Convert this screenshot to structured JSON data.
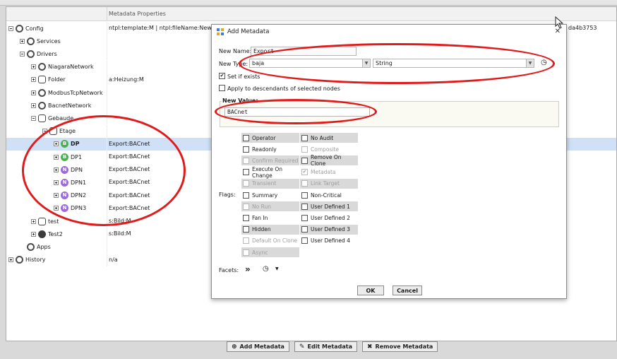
{
  "header": {
    "metadata_properties": "Metadata Properties"
  },
  "tree": [
    {
      "label": "Config",
      "value": "ntpl:template:M | ntpl:fileName:NewCon"
    },
    {
      "label": "Services",
      "value": ""
    },
    {
      "label": "Drivers",
      "value": ""
    },
    {
      "label": "NiagaraNetwork",
      "value": ""
    },
    {
      "label": "Folder",
      "value": "a:Heizung:M"
    },
    {
      "label": "ModbusTcpNetwork",
      "value": ""
    },
    {
      "label": "BacnetNetwork",
      "value": ""
    },
    {
      "label": "Gebaude",
      "value": ""
    },
    {
      "label": "Etage",
      "value": ""
    },
    {
      "label": "DP",
      "value": "Export:BACnet"
    },
    {
      "label": "DP1",
      "value": "Export:BACnet"
    },
    {
      "label": "DPN",
      "value": "Export:BACnet"
    },
    {
      "label": "DPN1",
      "value": "Export:BACnet"
    },
    {
      "label": "DPN2",
      "value": "Export:BACnet"
    },
    {
      "label": "DPN3",
      "value": "Export:BACnet"
    },
    {
      "label": "test",
      "value": "s:Bild:M"
    },
    {
      "label": "Test2",
      "value": "s:Bild:M"
    },
    {
      "label": "Apps",
      "value": ""
    },
    {
      "label": "History",
      "value": "n/a"
    }
  ],
  "right_fragment": "da4b3753",
  "toolbar": {
    "add": "Add Metadata",
    "edit": "Edit Metadata",
    "remove": "Remove Metadata"
  },
  "dialog": {
    "title": "Add Metadata",
    "new_name_label": "New Name:",
    "new_name_value": "Export",
    "new_type_label": "New Type:",
    "type_module": "baja",
    "type_name": "String",
    "set_if_exists": "Set if exists",
    "apply_descendants": "Apply to descendants of selected nodes",
    "new_value_label": "New Value:",
    "new_value": "BACnet",
    "flags_label": "Flags:",
    "flags_left": [
      {
        "label": "Operator",
        "checked": false,
        "disabled": false
      },
      {
        "label": "Readonly",
        "checked": false,
        "disabled": false
      },
      {
        "label": "Confirm Required",
        "checked": false,
        "disabled": true
      },
      {
        "label": "Execute On Change",
        "checked": false,
        "disabled": false
      },
      {
        "label": "Transient",
        "checked": false,
        "disabled": true
      },
      {
        "label": "Summary",
        "checked": false,
        "disabled": false
      },
      {
        "label": "No Run",
        "checked": false,
        "disabled": true
      },
      {
        "label": "Fan In",
        "checked": false,
        "disabled": false
      },
      {
        "label": "Hidden",
        "checked": false,
        "disabled": false
      },
      {
        "label": "Default On Clone",
        "checked": false,
        "disabled": true
      },
      {
        "label": "Async",
        "checked": false,
        "disabled": true
      }
    ],
    "flags_right": [
      {
        "label": "No Audit",
        "checked": false,
        "disabled": false
      },
      {
        "label": "Composite",
        "checked": false,
        "disabled": true
      },
      {
        "label": "Remove On Clone",
        "checked": false,
        "disabled": false
      },
      {
        "label": "Metadata",
        "checked": true,
        "disabled": true
      },
      {
        "label": "Link Target",
        "checked": false,
        "disabled": true
      },
      {
        "label": "Non-Critical",
        "checked": false,
        "disabled": false
      },
      {
        "label": "User Defined 1",
        "checked": false,
        "disabled": false
      },
      {
        "label": "User Defined 2",
        "checked": false,
        "disabled": false
      },
      {
        "label": "User Defined 3",
        "checked": false,
        "disabled": false
      },
      {
        "label": "User Defined 4",
        "checked": false,
        "disabled": false
      }
    ],
    "facets_label": "Facets:",
    "ok": "OK",
    "cancel": "Cancel"
  }
}
